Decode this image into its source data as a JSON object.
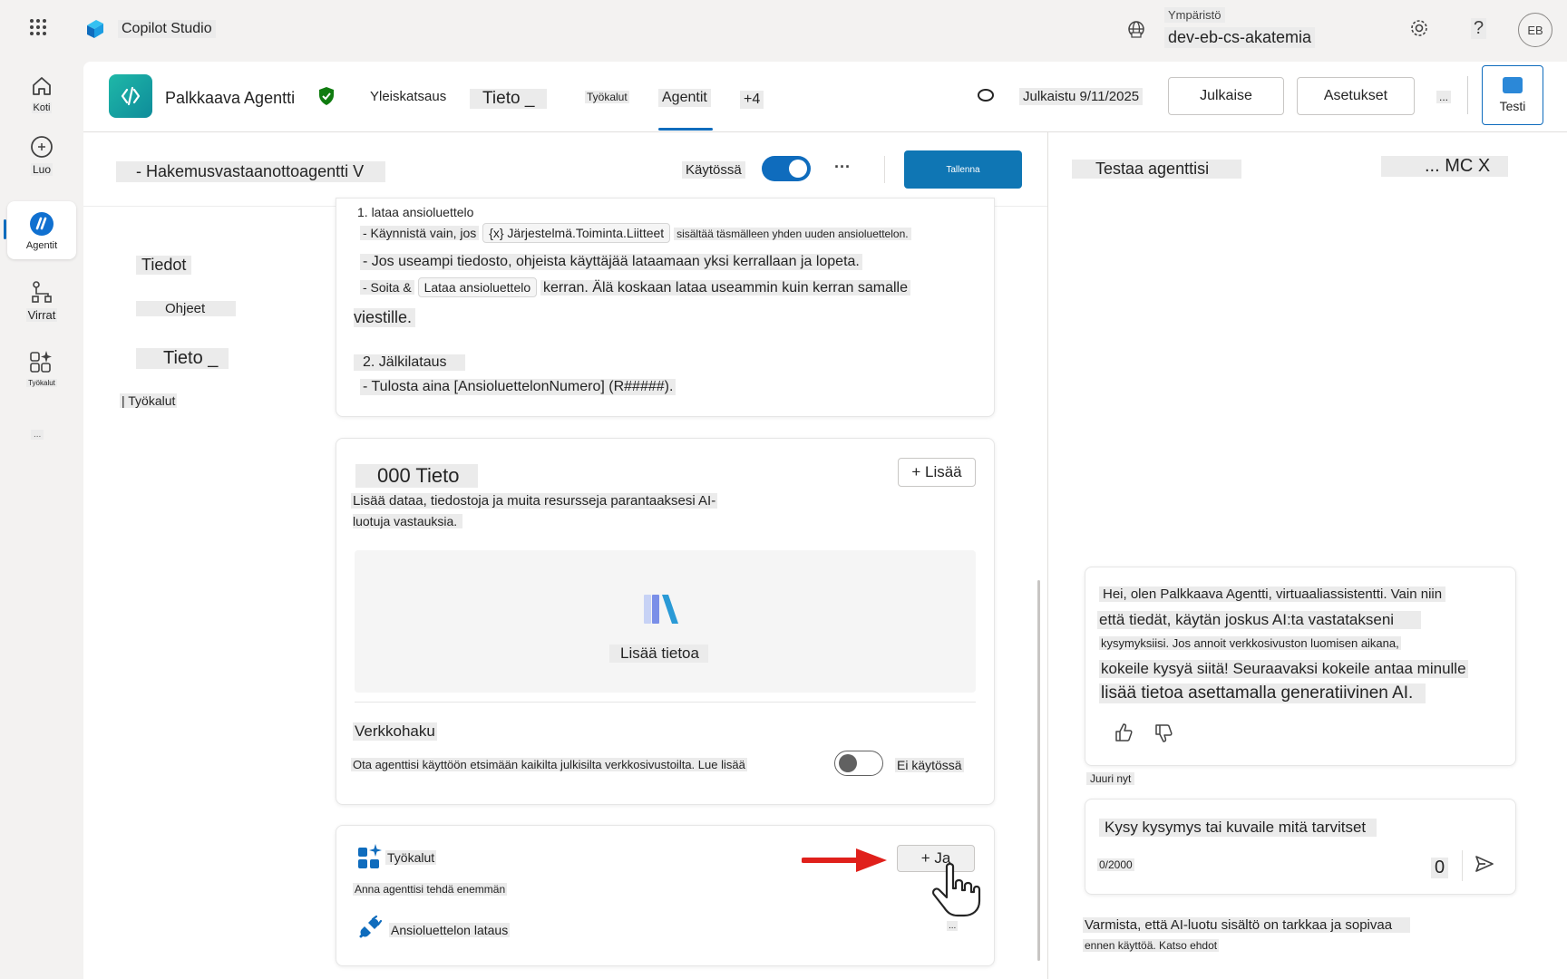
{
  "app": {
    "name": "Copilot Studio",
    "environment_label": "Ympäristö",
    "environment_name": "dev-eb-cs-akatemia",
    "user_initials": "EB",
    "help": "?"
  },
  "rail": {
    "items": [
      {
        "label": "Koti",
        "icon": "home-icon"
      },
      {
        "label": "Luo",
        "icon": "plus-circle-icon"
      },
      {
        "label": "Agentit",
        "icon": "agent-icon"
      },
      {
        "label": "Virrat",
        "icon": "flow-icon"
      },
      {
        "label": "Työkalut",
        "icon": "tools-icon"
      },
      {
        "label": "...",
        "icon": "more-icon"
      }
    ]
  },
  "agent": {
    "name": "Palkkaava Agentti",
    "published": "Julkaistu 9/11/2025",
    "tabs": [
      "Yleiskatsaus",
      "Tieto _",
      "Työkalut",
      "Agentit",
      "+4"
    ],
    "active_tab": "Agentit",
    "publish_label": "Julkaise",
    "settings_label": "Asetukset",
    "more_label": "...",
    "test_label": "Testi"
  },
  "subagent": {
    "title": "- Hakemusvastaanottoagentti V",
    "enabled_label": "Käytössä",
    "save_label": "Tallenna",
    "more": "···"
  },
  "side_nav": {
    "items": [
      "Tiedot",
      "Ohjeet",
      "Tieto _",
      "| Työkalut"
    ]
  },
  "instructions": {
    "line1": "1. lataa ansioluettelo",
    "line2_prefix": "- Käynnistä vain, jos",
    "line2_chip": "{x} Järjestelmä.Toiminta.Liitteet",
    "line2_suffix": "sisältää täsmälleen yhden uuden ansioluettelon.",
    "line3": "- Jos useampi tiedosto, ohjeista käyttäjää lataamaan yksi kerrallaan ja lopeta.",
    "line4_prefix": "- Soita &",
    "line4_chip": "Lataa ansioluettelo",
    "line4_suffix": "kerran. Älä koskaan lataa useammin kuin kerran samalle",
    "line5": "viestille.",
    "line6": "2. Jälkilataus",
    "line7": "- Tulosta aina [AnsioluettelonNumero] (R#####)."
  },
  "knowledge": {
    "title": "000 Tieto",
    "add_label": "+ Lisää",
    "description_1": "Lisää dataa, tiedostoja ja muita resursseja parantaaksesi AI-",
    "description_2": "luotuja vastauksia.",
    "add_knowledge_label": "Lisää tietoa",
    "web_search_title": "Verkkohaku",
    "web_search_desc": "Ota agenttisi käyttöön etsimään kaikilta julkisilta verkkosivustoilta. Lue lisää",
    "web_search_state": "Ei käytössä"
  },
  "tools": {
    "title": "Työkalut",
    "description": "Anna agenttisi tehdä enemmän",
    "add_label": "+ Ja",
    "item_name": "Ansioluettelon lataus",
    "item_more": "..."
  },
  "test_panel": {
    "title": "Testaa agenttisi",
    "actions": "... MC X",
    "message_lines": [
      "Hei, olen Palkkaava Agentti, virtuaaliassistentti. Vain niin",
      "että tiedät, käytän joskus AI:ta vastatakseni",
      "kysymyksiisi. Jos annoit verkkosivuston luomisen aikana,",
      "kokeile kysyä siitä! Seuraavaksi kokeile antaa minulle",
      "lisää tietoa asettamalla generatiivinen AI."
    ],
    "timestamp": "Juuri nyt",
    "input_placeholder": "Kysy kysymys tai kuvaile mitä tarvitset",
    "char_count": "0/2000",
    "attachment_count": "0",
    "disclaimer_1": "Varmista, että AI-luotu sisältö on tarkkaa ja sopivaa",
    "disclaimer_2": "ennen käyttöä. Katso ehdot"
  },
  "colors": {
    "accent": "#0f6cbd",
    "save_bg": "#0f76b4",
    "toggle_on": "#0f6cbd",
    "arrow": "#e0201b",
    "shield": "#107c10"
  }
}
